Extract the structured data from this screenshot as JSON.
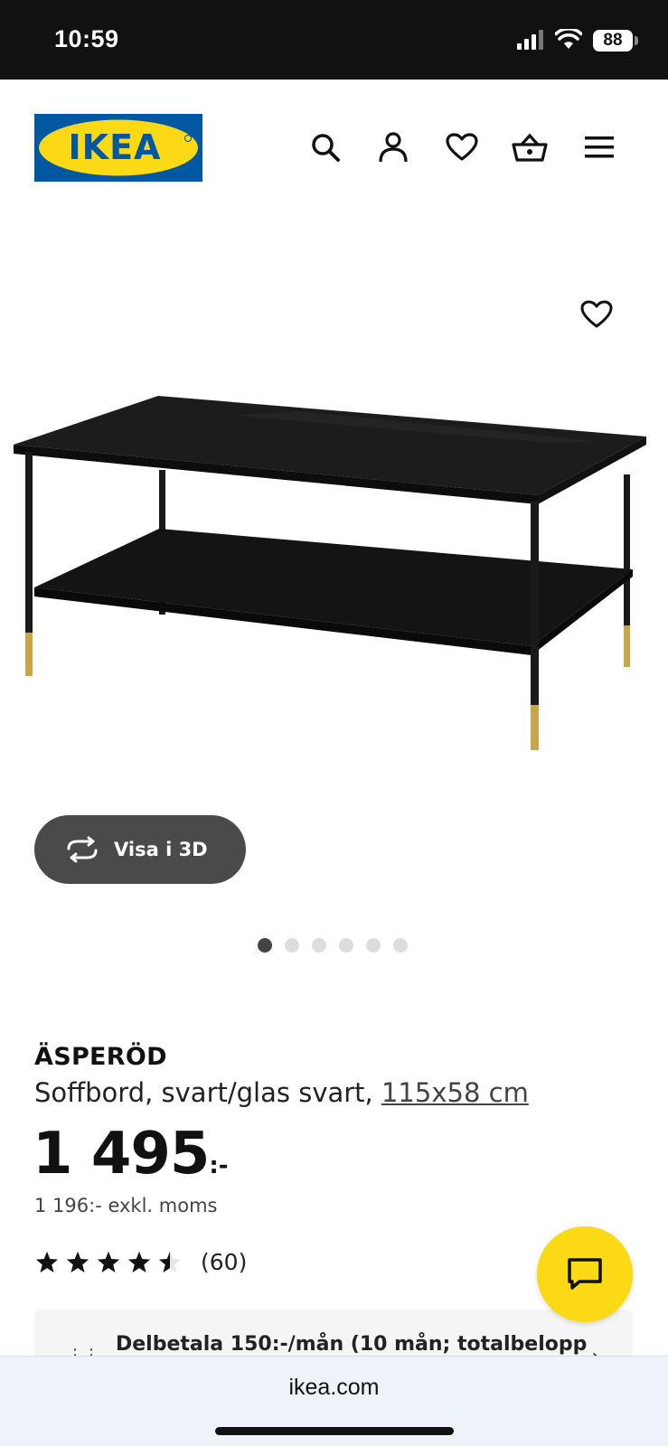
{
  "status_bar": {
    "time": "10:59",
    "battery": "88"
  },
  "header": {
    "logo_text": "IKEA",
    "icons": [
      "search-icon",
      "user-icon",
      "heart-icon",
      "basket-icon",
      "menu-icon"
    ]
  },
  "gallery": {
    "view_3d_label": "Visa i 3D",
    "dot_count": 6,
    "active_dot": 1
  },
  "product": {
    "name": "ÄSPERÖD",
    "description": "Soffbord, svart/glas svart, ",
    "size": "115x58 cm",
    "price": "1 495",
    "price_suffix": ":-",
    "price_excl_vat": "1 196:- exkl. moms",
    "rating": 4.5,
    "rating_count": "(60)"
  },
  "installment": {
    "text": "Delbetala 150:-/mån (10 mån; totalbelopp"
  },
  "browser": {
    "url": "ikea.com"
  },
  "colors": {
    "ikea_blue": "#0058a3",
    "ikea_yellow": "#fbd914",
    "gold": "#c9a64a"
  }
}
